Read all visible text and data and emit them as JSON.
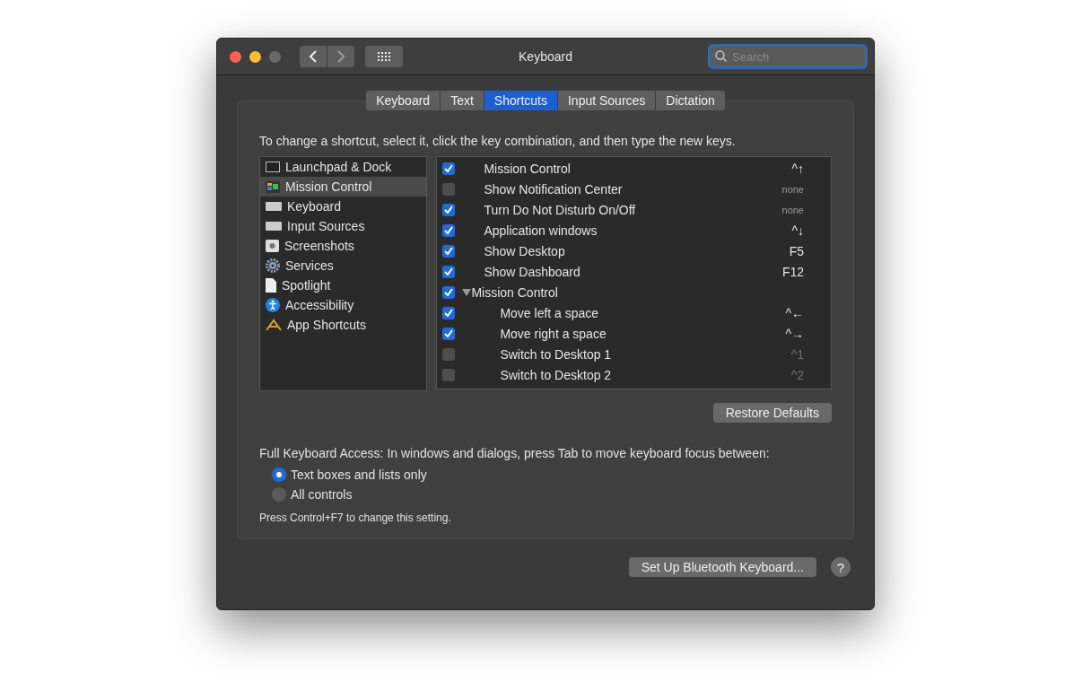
{
  "window": {
    "title": "Keyboard"
  },
  "search": {
    "placeholder": "Search"
  },
  "tabs": [
    {
      "label": "Keyboard",
      "selected": false
    },
    {
      "label": "Text",
      "selected": false
    },
    {
      "label": "Shortcuts",
      "selected": true
    },
    {
      "label": "Input Sources",
      "selected": false
    },
    {
      "label": "Dictation",
      "selected": false
    }
  ],
  "instruction": "To change a shortcut, select it, click the key combination, and then type the new keys.",
  "categories": [
    {
      "label": "Launchpad & Dock",
      "selected": false
    },
    {
      "label": "Mission Control",
      "selected": true
    },
    {
      "label": "Keyboard",
      "selected": false
    },
    {
      "label": "Input Sources",
      "selected": false
    },
    {
      "label": "Screenshots",
      "selected": false
    },
    {
      "label": "Services",
      "selected": false
    },
    {
      "label": "Spotlight",
      "selected": false
    },
    {
      "label": "Accessibility",
      "selected": false
    },
    {
      "label": "App Shortcuts",
      "selected": false
    }
  ],
  "shortcuts": [
    {
      "label": "Mission Control",
      "checked": true,
      "keys": "^↑"
    },
    {
      "label": "Show Notification Center",
      "checked": false,
      "keys": "none"
    },
    {
      "label": "Turn Do Not Disturb On/Off",
      "checked": true,
      "keys": "none"
    },
    {
      "label": "Application windows",
      "checked": true,
      "keys": "^↓"
    },
    {
      "label": "Show Desktop",
      "checked": true,
      "keys": "F5"
    },
    {
      "label": "Show Dashboard",
      "checked": true,
      "keys": "F12"
    },
    {
      "label": "Mission Control",
      "checked": true,
      "expanded": true,
      "children": [
        {
          "label": "Move left a space",
          "checked": true,
          "keys": "^←"
        },
        {
          "label": "Move right a space",
          "checked": true,
          "keys": "^→"
        },
        {
          "label": "Switch to Desktop 1",
          "checked": false,
          "keys": "^1"
        },
        {
          "label": "Switch to Desktop 2",
          "checked": false,
          "keys": "^2"
        }
      ]
    }
  ],
  "restore_button": "Restore Defaults",
  "access_label": "Full Keyboard Access: In windows and dialogs, press Tab to move keyboard focus between:",
  "access_options": [
    {
      "label": "Text boxes and lists only",
      "selected": true
    },
    {
      "label": "All controls",
      "selected": false
    }
  ],
  "access_hint": "Press Control+F7 to change this setting.",
  "bluetooth_button": "Set Up Bluetooth Keyboard...",
  "help_button": "?"
}
